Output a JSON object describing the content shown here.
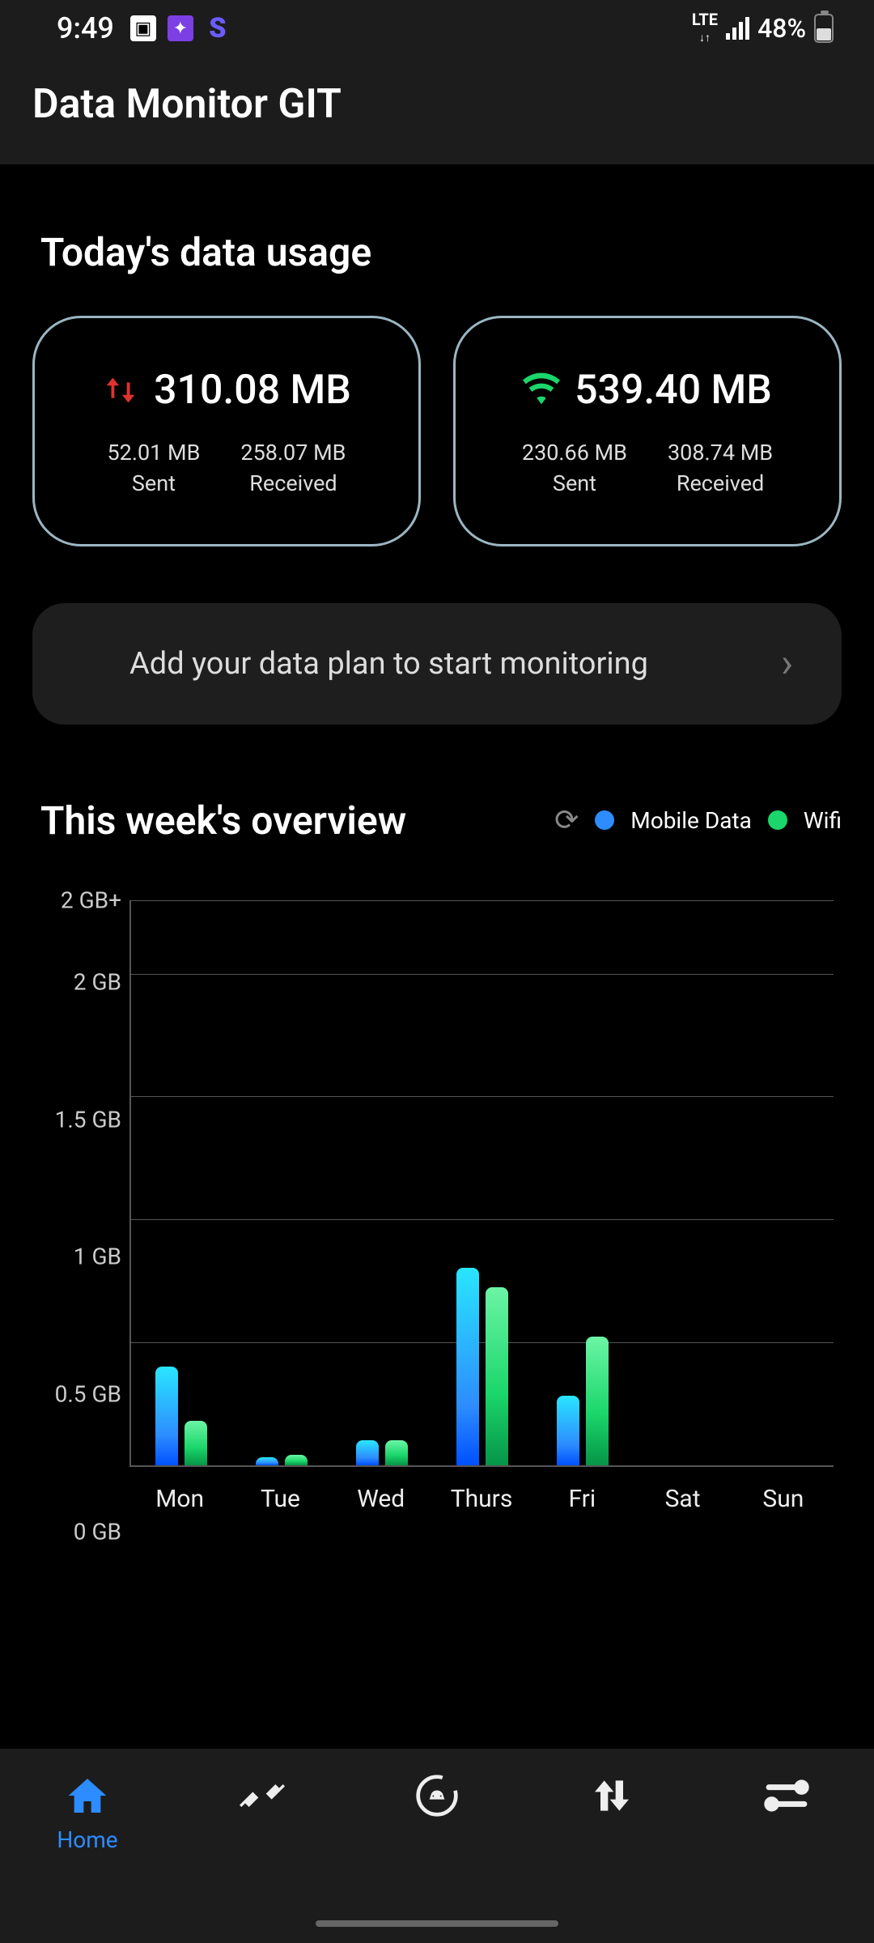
{
  "status_bar": {
    "time": "9:49",
    "network_type": "LTE",
    "battery_percent": "48%"
  },
  "header": {
    "title": "Data Monitor GIT"
  },
  "today": {
    "title": "Today's data usage",
    "mobile": {
      "total": "310.08 MB",
      "sent_value": "52.01 MB",
      "sent_label": "Sent",
      "received_value": "258.07 MB",
      "received_label": "Received"
    },
    "wifi": {
      "total": "539.40 MB",
      "sent_value": "230.66 MB",
      "sent_label": "Sent",
      "received_value": "308.74 MB",
      "received_label": "Received"
    }
  },
  "plan_banner": {
    "text": "Add your data plan to start monitoring"
  },
  "week": {
    "title": "This week's overview",
    "legend_mobile": "Mobile Data",
    "legend_wifi": "Wifi"
  },
  "chart_data": {
    "type": "bar",
    "title": "This week's overview",
    "xlabel": "",
    "ylabel": "",
    "ylim": [
      0,
      2.3
    ],
    "y_ticks": [
      "0 GB",
      "0.5 GB",
      "1 GB",
      "1.5 GB",
      "2 GB",
      "2 GB+"
    ],
    "categories": [
      "Mon",
      "Tue",
      "Wed",
      "Thurs",
      "Fri",
      "Sat",
      "Sun"
    ],
    "series": [
      {
        "name": "Mobile Data",
        "color": "#2d8cff",
        "values": [
          0.4,
          0.03,
          0.1,
          0.8,
          0.28,
          0,
          0
        ]
      },
      {
        "name": "Wifi",
        "color": "#1bd66a",
        "values": [
          0.18,
          0.04,
          0.1,
          0.72,
          0.52,
          0,
          0
        ]
      }
    ]
  },
  "bottom_nav": {
    "home": "Home"
  },
  "colors": {
    "accent_mobile": "#2d8cff",
    "accent_wifi": "#1bd66a",
    "card_border": "#9ab6c2",
    "mobile_arrows": "#e03131"
  }
}
